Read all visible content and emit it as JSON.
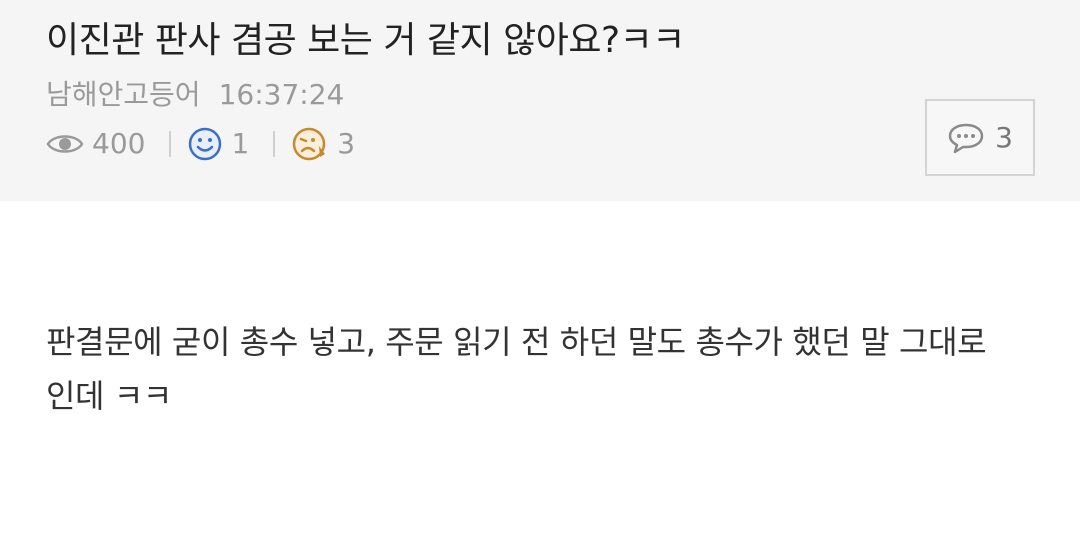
{
  "post": {
    "title": "이진관 판사 겸공 보는 거 같지 않아요?ㅋㅋ",
    "author": "남해안고등어",
    "time": "16:37:24",
    "views": "400",
    "likes": "1",
    "dislikes": "3",
    "comment_count": "3",
    "body_line1": "판결문에 굳이 총수 넣고, 주문 읽기 전 하던 말도 총수가 했던 말 그대로",
    "body_line2": "인데 ㅋㅋ"
  },
  "icons": {
    "views": "eye-icon",
    "likes": "smile-icon",
    "dislikes": "frown-icon",
    "comments": "speech-bubble-icon"
  },
  "colors": {
    "header_bg": "#f5f5f5",
    "meta_text": "#9a9a9a",
    "like_icon": "#3a6fc9",
    "dislike_icon": "#c58a2e"
  }
}
